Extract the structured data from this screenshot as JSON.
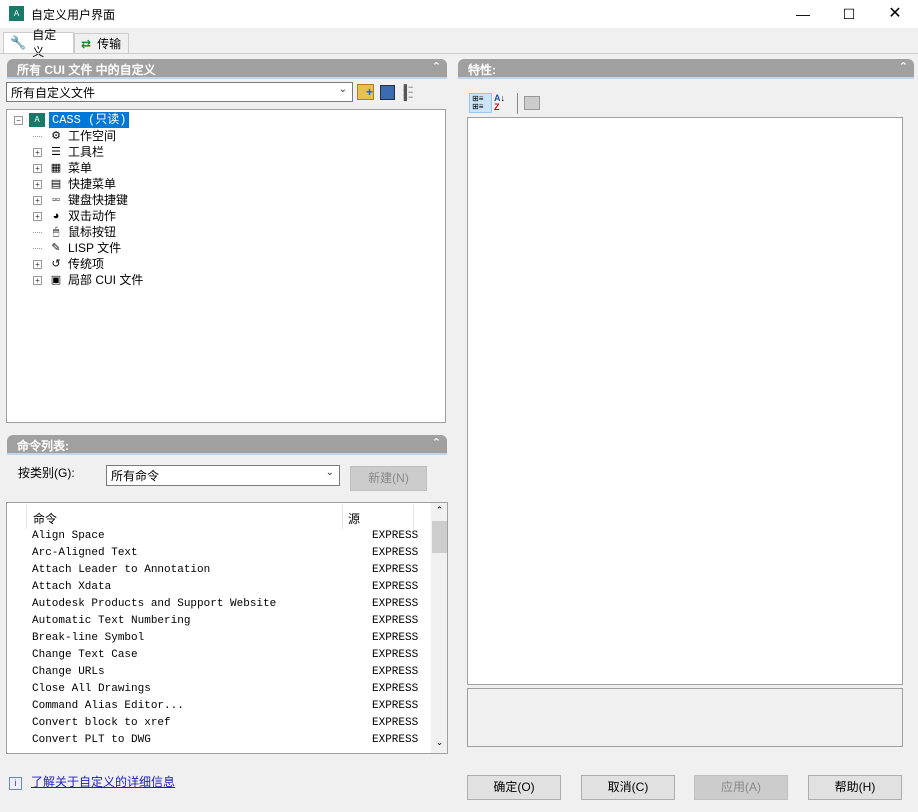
{
  "window": {
    "title": "自定义用户界面",
    "app_icon": "autocad-cui-icon",
    "controls": [
      "minimize",
      "maximize",
      "close"
    ]
  },
  "tabs": [
    {
      "label": "自定义",
      "icon": "wrench-icon",
      "active": true
    },
    {
      "label": "传输",
      "icon": "transfer-arrows-icon",
      "active": false
    }
  ],
  "customizations_panel": {
    "header": "所有 CUI 文件 中的自定义",
    "file_select": "所有自定义文件",
    "tree": {
      "root": {
        "label": "CASS (只读)",
        "selected": true
      },
      "items": [
        {
          "label": "工作空间",
          "icon": "gears-icon",
          "expandable": false
        },
        {
          "label": "工具栏",
          "icon": "toolbar-icon",
          "expandable": true
        },
        {
          "label": "菜单",
          "icon": "menu-icon",
          "expandable": true
        },
        {
          "label": "快捷菜单",
          "icon": "shortcut-menu-icon",
          "expandable": true
        },
        {
          "label": "键盘快捷键",
          "icon": "keyboard-icon",
          "expandable": true
        },
        {
          "label": "双击动作",
          "icon": "double-click-icon",
          "expandable": true
        },
        {
          "label": "鼠标按钮",
          "icon": "mouse-icon",
          "expandable": false
        },
        {
          "label": "LISP 文件",
          "icon": "lisp-icon",
          "expandable": false
        },
        {
          "label": "传统项",
          "icon": "legacy-icon",
          "expandable": true
        },
        {
          "label": "局部 CUI 文件",
          "icon": "cui-file-icon",
          "expandable": true
        }
      ]
    }
  },
  "command_list": {
    "header": "命令列表:",
    "filter_label": "按类别(G):",
    "filter_value": "所有命令",
    "new_button": "新建(N)",
    "columns": [
      "命令",
      "源"
    ],
    "rows": [
      [
        "Align Space",
        "EXPRESS"
      ],
      [
        "Arc-Aligned Text",
        "EXPRESS"
      ],
      [
        "Attach Leader to Annotation",
        "EXPRESS"
      ],
      [
        "Attach Xdata",
        "EXPRESS"
      ],
      [
        "Autodesk Products and Support Website",
        "EXPRESS"
      ],
      [
        "Automatic Text Numbering",
        "EXPRESS"
      ],
      [
        "Break-line Symbol",
        "EXPRESS"
      ],
      [
        "Change Text Case",
        "EXPRESS"
      ],
      [
        "Change URLs",
        "EXPRESS"
      ],
      [
        "Close All Drawings",
        "EXPRESS"
      ],
      [
        "Command Alias Editor...",
        "EXPRESS"
      ],
      [
        "Convert block to xref",
        "EXPRESS"
      ],
      [
        "Convert PLT to DWG",
        "EXPRESS"
      ]
    ]
  },
  "info_link": "了解关于自定义的详细信息",
  "properties_panel": {
    "header": "特性:"
  },
  "buttons": {
    "ok": "确定(O)",
    "cancel": "取消(C)",
    "apply": "应用(A)",
    "help": "帮助(H)"
  }
}
